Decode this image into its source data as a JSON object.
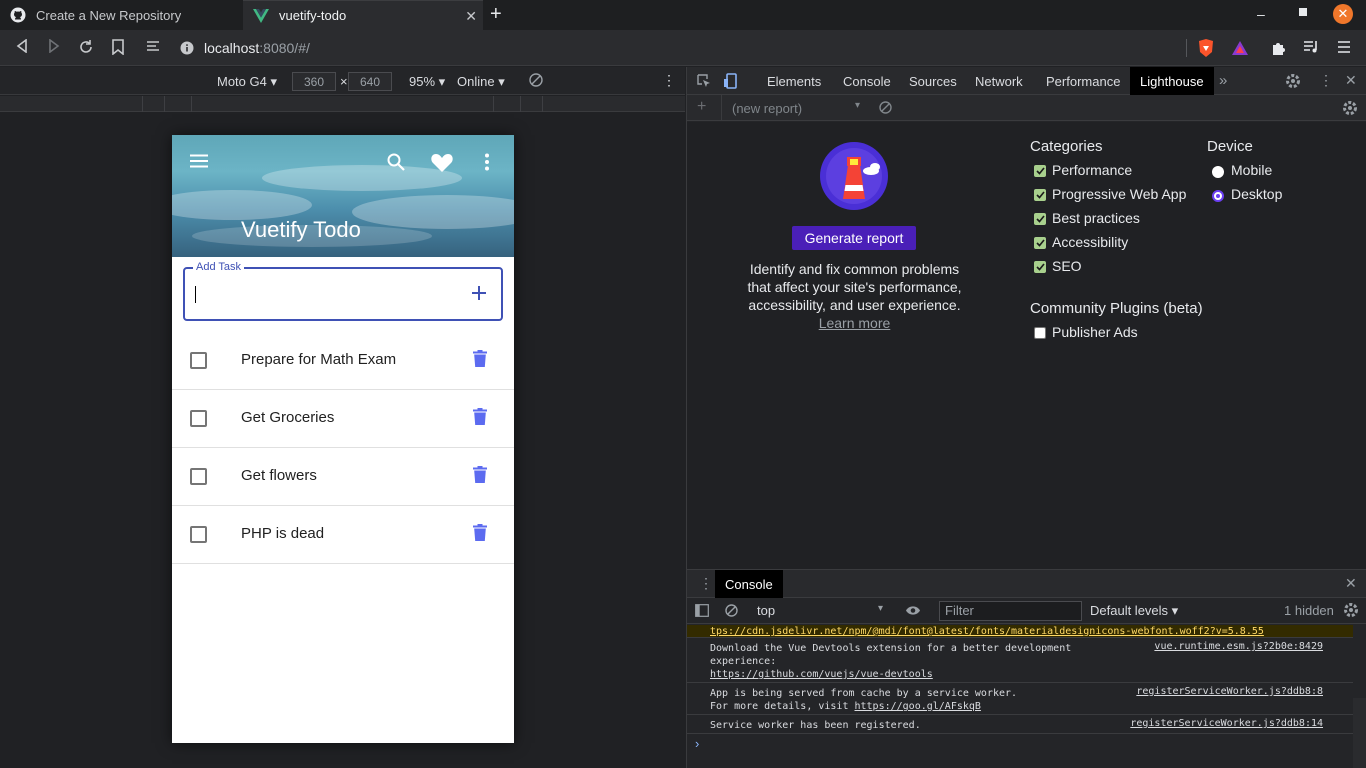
{
  "browser": {
    "tabs": [
      {
        "label": "Create a New Repository",
        "icon": "github-icon",
        "active": false
      },
      {
        "label": "vuetify-todo",
        "icon": "vue-icon",
        "active": true
      }
    ],
    "url_host": "localhost",
    "url_rest": ":8080/#/"
  },
  "device_toolbar": {
    "device": "Moto G4",
    "width": "360",
    "times": "×",
    "height": "640",
    "zoom": "95%",
    "network": "Online"
  },
  "app": {
    "title": "Vuetify Todo",
    "add_label": "Add Task",
    "todos": [
      {
        "label": "Prepare for Math Exam",
        "done": false
      },
      {
        "label": "Get Groceries",
        "done": false
      },
      {
        "label": "Get flowers",
        "done": false
      },
      {
        "label": "PHP is dead",
        "done": false
      }
    ]
  },
  "devtools": {
    "tabs": [
      "Elements",
      "Console",
      "Sources",
      "Network",
      "Performance",
      "Lighthouse"
    ],
    "selected_tab": "Lighthouse",
    "report_select": "(new report)",
    "generate": "Generate report",
    "description": "Identify and fix common problems that affect your site's performance, accessibility, and user experience.",
    "learn_more": "Learn more",
    "categories_heading": "Categories",
    "categories": [
      {
        "label": "Performance",
        "checked": true
      },
      {
        "label": "Progressive Web App",
        "checked": true
      },
      {
        "label": "Best practices",
        "checked": true
      },
      {
        "label": "Accessibility",
        "checked": true
      },
      {
        "label": "SEO",
        "checked": true
      }
    ],
    "plugins_heading": "Community Plugins (beta)",
    "plugins": [
      {
        "label": "Publisher Ads",
        "checked": false
      }
    ],
    "device_heading": "Device",
    "devices": [
      {
        "label": "Mobile",
        "selected": false
      },
      {
        "label": "Desktop",
        "selected": true
      }
    ]
  },
  "console": {
    "tab": "Console",
    "context": "top",
    "filter_placeholder": "Filter",
    "levels": "Default levels",
    "hidden": "1 hidden",
    "logs": [
      {
        "text": "tps://cdn.jsdelivr.net/npm/@mdi/font@latest/fonts/materialdesignicons-webfont.woff2?v=5.8.55"
      },
      {
        "line1": "Download the Vue Devtools extension for a better development",
        "line2": "experience:",
        "line3": "https://github.com/vuejs/vue-devtools",
        "source": "vue.runtime.esm.js?2b0e:8429"
      },
      {
        "line1": "App is being served from cache by a service worker.",
        "line2_prefix": "For more details, visit ",
        "line2_link": "https://goo.gl/AFskqB",
        "source": "registerServiceWorker.js?ddb8:8"
      },
      {
        "line1": "Service worker has been registered.",
        "source": "registerServiceWorker.js?ddb8:14"
      }
    ]
  },
  "colors": {
    "primary": "#3f51b5",
    "trash": "#5c6bf0",
    "lighthouse_button": "#4a1fb8",
    "checkbox": "#a8d08d"
  }
}
